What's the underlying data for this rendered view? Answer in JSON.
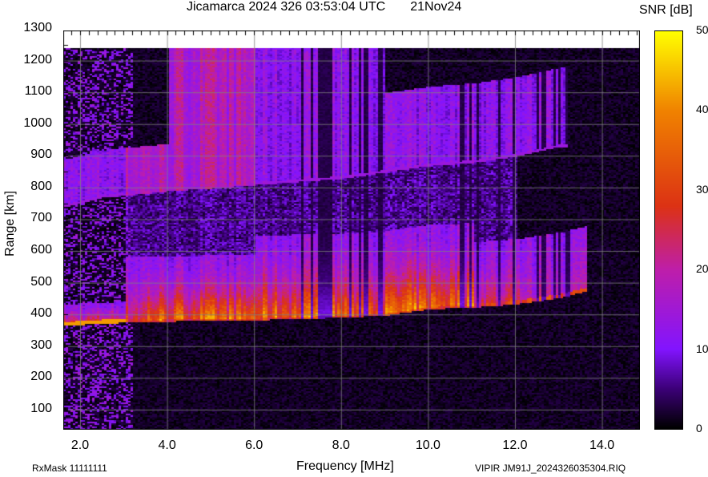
{
  "header": {
    "title": "Jicamarca 2024 326 03:53:04 UTC       21Nov24",
    "colorbar_title": "SNR [dB]"
  },
  "footer": {
    "rxmask": "RxMask 11111111",
    "file": "VIPIR  JM91J_2024326035304.RIQ"
  },
  "chart_data": {
    "type": "heatmap",
    "title": "Jicamarca 2024 326 03:53:04 UTC 21Nov24",
    "xlabel": "Frequency [MHz]",
    "ylabel": "Range [km]",
    "xlim": [
      1.6,
      15.0
    ],
    "ylim": [
      38,
      1300
    ],
    "xticks": [
      "2.0",
      "4.0",
      "6.0",
      "8.0",
      "10.0",
      "12.0",
      "14.0"
    ],
    "yticks": [
      "100",
      "200",
      "300",
      "400",
      "500",
      "600",
      "700",
      "800",
      "900",
      "1000",
      "1100",
      "1200",
      "1300"
    ],
    "colorbar": {
      "label": "SNR [dB]",
      "range": [
        0,
        50
      ],
      "ticks": [
        "0",
        "10",
        "20",
        "30",
        "40",
        "50"
      ]
    },
    "grid": true,
    "data_max_range_km": 1240,
    "traces": [
      {
        "name": "F-layer echo (1st hop) lower edge",
        "freq": [
          1.6,
          2.5,
          4,
          6,
          8,
          9,
          10,
          11,
          12,
          13,
          13.6
        ],
        "range": [
          372,
          380,
          386,
          390,
          398,
          405,
          425,
          430,
          440,
          460,
          480
        ],
        "peak_snr_db": 35
      },
      {
        "name": "2nd hop lower edge",
        "freq": [
          1.6,
          2.5,
          4,
          6,
          8,
          9,
          10,
          11,
          12,
          13
        ],
        "range": [
          740,
          770,
          790,
          810,
          830,
          850,
          870,
          880,
          900,
          930
        ],
        "peak_snr_db": 22
      }
    ]
  }
}
